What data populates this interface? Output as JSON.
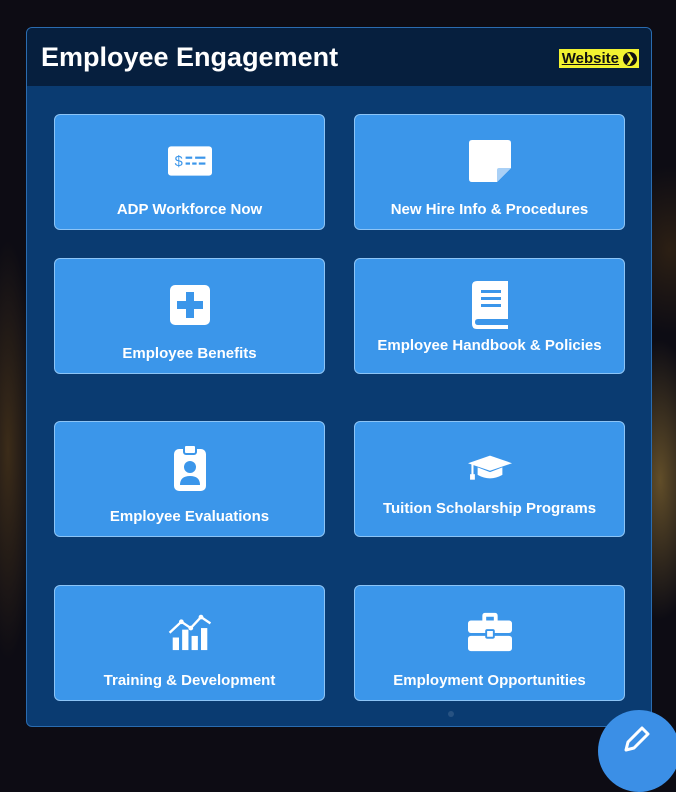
{
  "header": {
    "title": "Employee Engagement",
    "website_label": "Website"
  },
  "tiles": [
    {
      "label": "ADP Workforce Now",
      "icon": "paycheck-icon"
    },
    {
      "label": "New Hire Info & Procedures",
      "icon": "note-icon"
    },
    {
      "label": "Employee Benefits",
      "icon": "medical-plus-icon"
    },
    {
      "label": "Employee Handbook & Policies",
      "icon": "book-icon"
    },
    {
      "label": "Employee Evaluations",
      "icon": "id-badge-icon"
    },
    {
      "label": "Tuition Scholarship Programs",
      "icon": "graduation-cap-icon"
    },
    {
      "label": "Training & Development",
      "icon": "chart-growth-icon"
    },
    {
      "label": "Employment Opportunities",
      "icon": "briefcase-icon"
    }
  ],
  "colors": {
    "panel": "#0a3b71",
    "header": "#061f3e",
    "tile": "#3b96ea",
    "website_highlight": "#f2f230"
  }
}
